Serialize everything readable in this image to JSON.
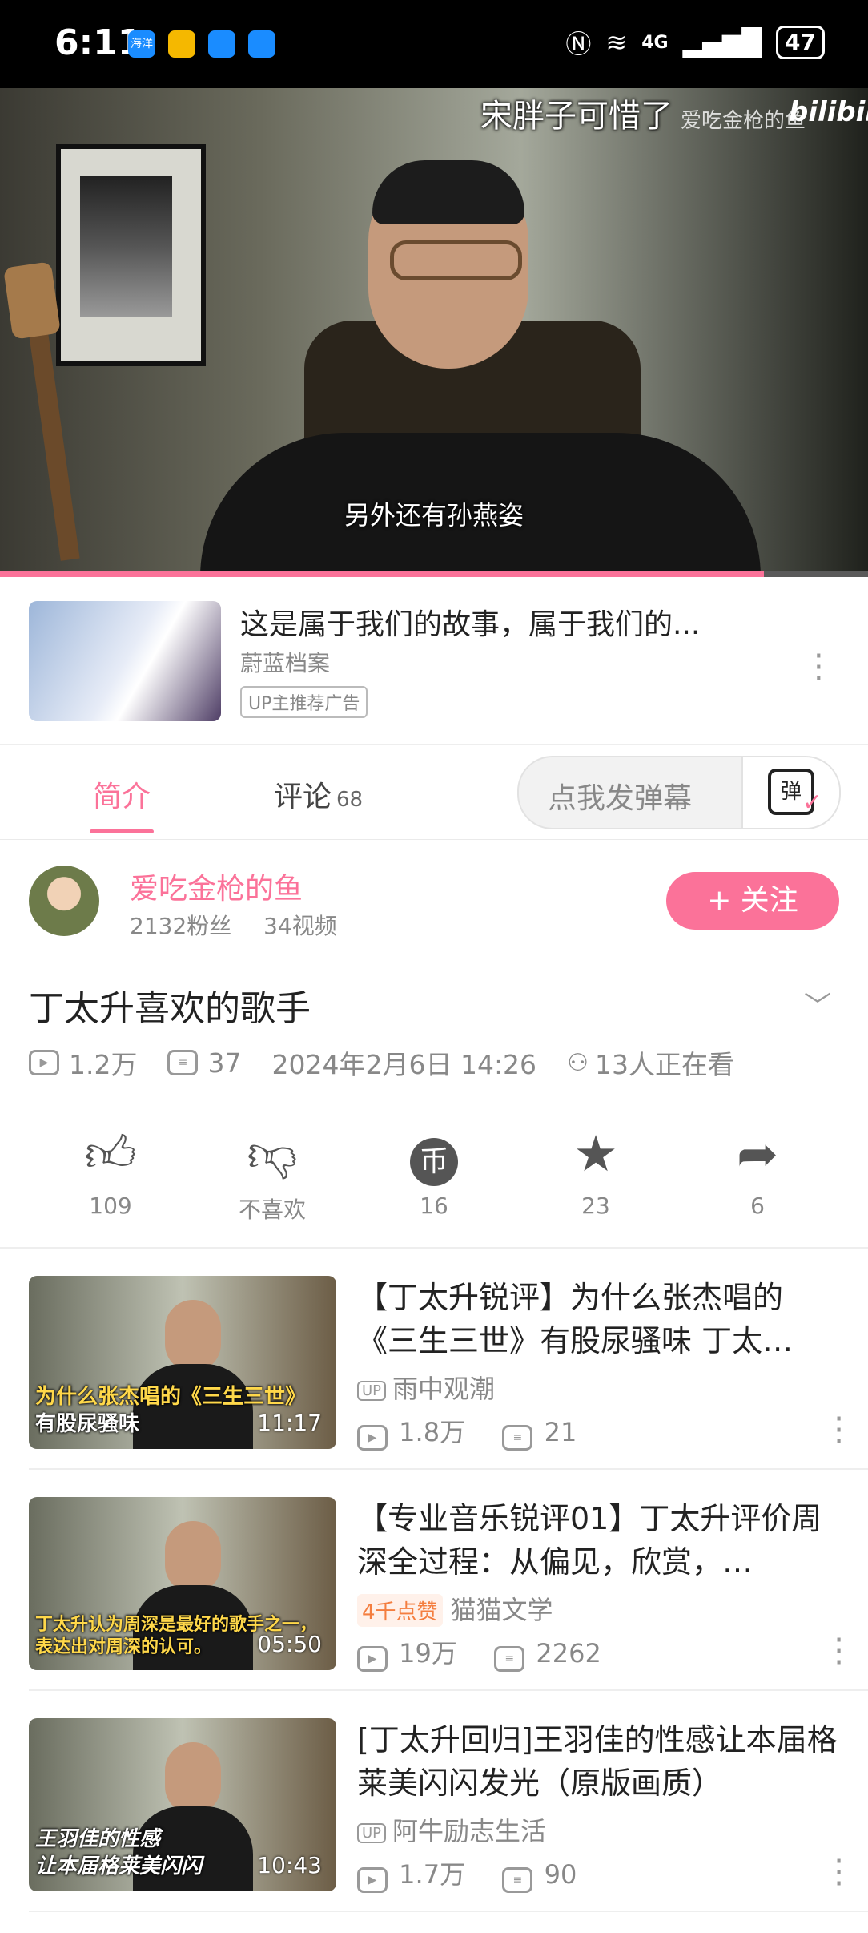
{
  "status_bar": {
    "time": "6:11",
    "apps": [
      "海洋",
      "app-icon",
      "app-icon",
      "cloud-app"
    ],
    "network": "4G",
    "battery": "47"
  },
  "player": {
    "top_danmaku": "宋胖子可惜了",
    "watermark": "爱吃金枪的鱼",
    "logo": "bilibili",
    "subtitle": "另外还有孙燕姿",
    "progress": 0.88
  },
  "ad": {
    "title": "这是属于我们的故事，属于我们的...",
    "source": "蔚蓝档案",
    "badge": "UP主推荐广告"
  },
  "tabs": {
    "intro": "简介",
    "comments": "评论",
    "comments_count": "68",
    "danmaku_placeholder": "点我发弹幕",
    "danmaku_toggle": "弹"
  },
  "uploader": {
    "name": "爱吃金枪的鱼",
    "fans": "2132粉丝",
    "videos": "34视频",
    "follow": "+ 关注"
  },
  "video": {
    "title": "丁太升喜欢的歌手",
    "views": "1.2万",
    "danmaku": "37",
    "date": "2024年2月6日 14:26",
    "watching": "13人正在看"
  },
  "actions": [
    {
      "icon": "thumbs-up-icon",
      "label": "109"
    },
    {
      "icon": "thumbs-down-icon",
      "label": "不喜欢"
    },
    {
      "icon": "coin-icon",
      "label": "16"
    },
    {
      "icon": "star-icon",
      "label": "23"
    },
    {
      "icon": "share-icon",
      "label": "6"
    }
  ],
  "recommendations": [
    {
      "title": "【丁太升锐评】为什么张杰唱的《三生三世》有股尿骚味 丁太…",
      "caption_line1": "为什么张杰唱的《三生三世》",
      "caption_line2": "有股尿骚味",
      "duration": "11:17",
      "up_tag": "UP",
      "uploader": "雨中观潮",
      "hot": "",
      "views": "1.8万",
      "danmaku": "21"
    },
    {
      "title": "【专业音乐锐评01】丁太升评价周深全过程：从偏见，欣赏，…",
      "caption_line1": "丁太升认为周深是最好的歌手之一，",
      "caption_line2": "表达出对周深的认可。",
      "duration": "05:50",
      "up_tag": "",
      "uploader": "猫猫文学",
      "hot": "4千点赞",
      "views": "19万",
      "danmaku": "2262"
    },
    {
      "title": "[丁太升回归]王羽佳的性感让本届格莱美闪闪发光（原版画质）",
      "caption_line1": "王羽佳的性感",
      "caption_line2": "让本届格莱美闪闪",
      "duration": "10:43",
      "up_tag": "UP",
      "uploader": "阿牛励志生活",
      "hot": "",
      "views": "1.7万",
      "danmaku": "90"
    }
  ]
}
